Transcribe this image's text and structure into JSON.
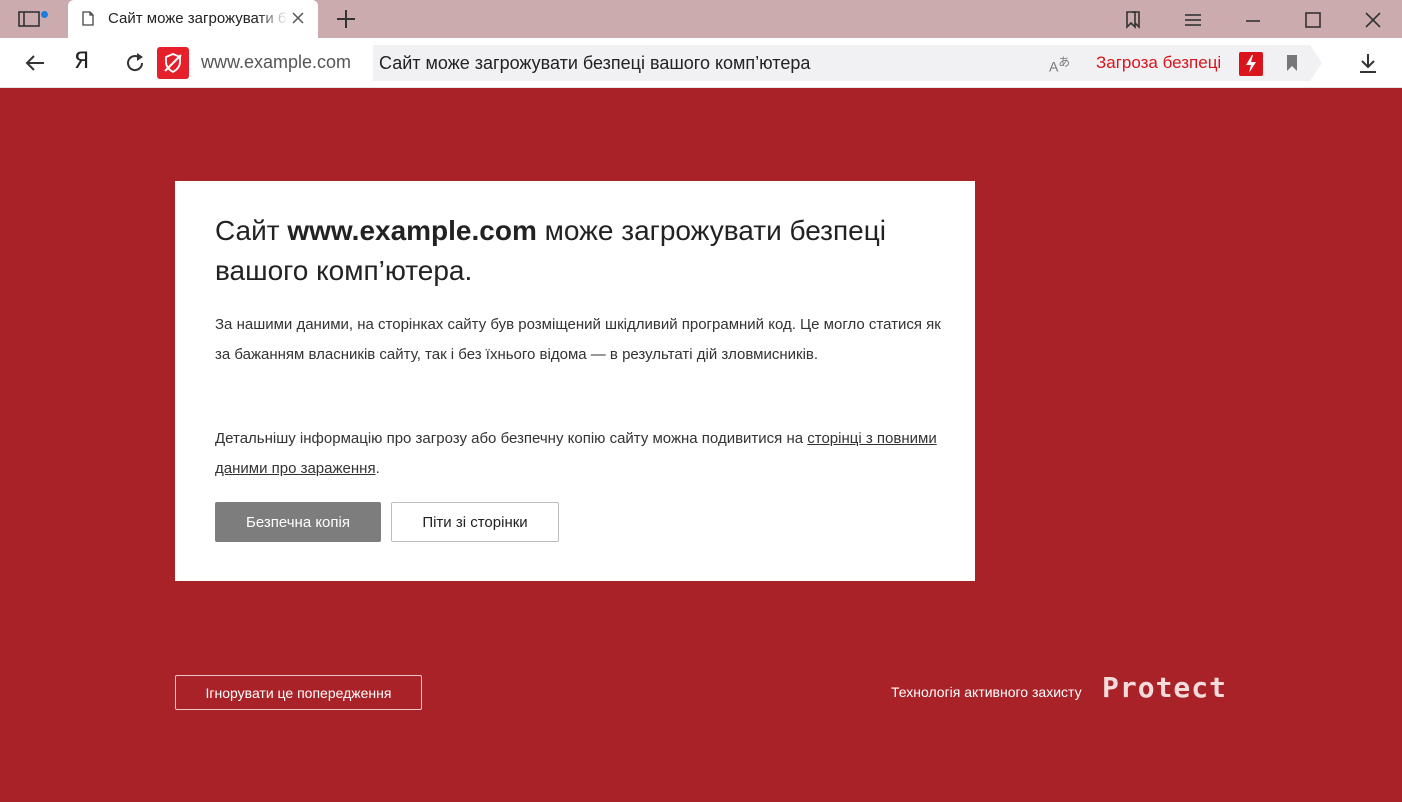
{
  "colors": {
    "danger_background": "#A82228",
    "tab_strip": "#CCABAF",
    "threat_red": "#D9141C",
    "safe_button": "#7D7D7D"
  },
  "tabs": [
    {
      "title": "Сайт може загрожувати безпеці вашого комп’ютера",
      "icon": "page-icon",
      "active": true
    }
  ],
  "address_bar": {
    "domain": "www.example.com",
    "page_title": "Сайт може загрожувати безпеці вашого комп’ютера",
    "threat_label": "Загроза безпеці",
    "logo_letter": "Я"
  },
  "warning": {
    "title_prefix": "Сайт ",
    "title_domain": "www.example.com",
    "title_suffix": " може загрожувати безпеці вашого комп’ютера.",
    "paragraph1": "За нашими даними, на сторінках сайту був розміщений шкідливий програмний код. Це могло статися як за бажанням власників сайту, так і без їхнього відома — в результаті дій зловмисників.",
    "paragraph2_text": "Детальнішу інформацію про загрозу або безпечну копію сайту можна подивитися на ",
    "paragraph2_link": "сторінці з повними даними про зараження",
    "paragraph2_end": ".",
    "safe_copy_button": "Безпечна копія",
    "leave_button": "Піти зі сторінки"
  },
  "footer": {
    "ignore_button": "Ігнорувати це попередження",
    "tagline": "Технологія активного захисту",
    "logo": "Protect"
  }
}
